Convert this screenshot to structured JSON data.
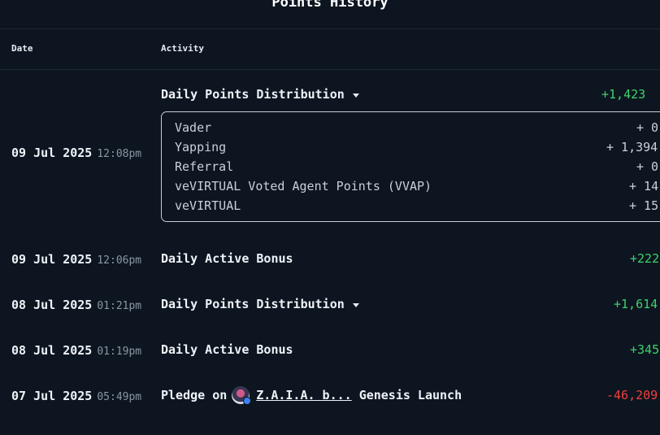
{
  "page": {
    "title": "Points History"
  },
  "columns": {
    "date": "Date",
    "activity": "Activity"
  },
  "rows": [
    {
      "date": "09 Jul 2025",
      "time": "12:08pm",
      "activity": "Daily Points Distribution",
      "amount": "+1,423",
      "breakdown": [
        {
          "label": "Vader",
          "value": "+ 0"
        },
        {
          "label": "Yapping",
          "value": "+ 1,394"
        },
        {
          "label": "Referral",
          "value": "+ 0"
        },
        {
          "label": "veVIRTUAL Voted Agent Points (VVAP)",
          "value": "+ 14"
        },
        {
          "label": "veVIRTUAL",
          "value": "+ 15"
        }
      ]
    },
    {
      "date": "09 Jul 2025",
      "time": "12:06pm",
      "activity": "Daily Active Bonus",
      "amount": "+222"
    },
    {
      "date": "08 Jul 2025",
      "time": "01:21pm",
      "activity": "Daily Points Distribution",
      "amount": "+1,614"
    },
    {
      "date": "08 Jul 2025",
      "time": "01:19pm",
      "activity": "Daily Active Bonus",
      "amount": "+345"
    },
    {
      "date": "07 Jul 2025",
      "time": "05:49pm",
      "activity_prefix": "Pledge on",
      "agent_name": "Z.A.I.A. b...",
      "activity_suffix": "Genesis Launch",
      "amount": "-46,209"
    }
  ],
  "colors": {
    "positive": "#3ed16b",
    "negative": "#f0413d",
    "background": "#0d1520"
  },
  "icons": {
    "expand": "chevron-down-icon",
    "agent_avatar": "agent-avatar-icon"
  }
}
